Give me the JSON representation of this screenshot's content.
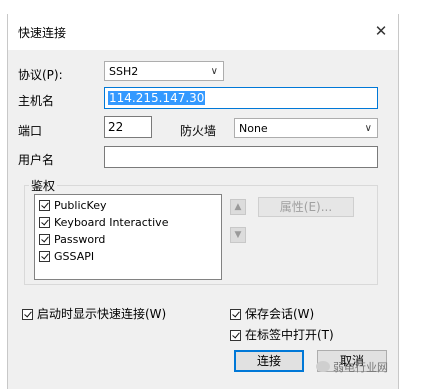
{
  "window": {
    "title": "快速连接"
  },
  "protocol": {
    "label": "协议(P):",
    "value": "SSH2"
  },
  "hostname": {
    "label": "主机名",
    "value": "114.215.147.30"
  },
  "port": {
    "label": "端口",
    "value": "22"
  },
  "firewall": {
    "label": "防火墙",
    "value": "None"
  },
  "username": {
    "label": "用户名",
    "value": ""
  },
  "auth": {
    "legend": "鉴权",
    "methods": [
      "PublicKey",
      "Keyboard Interactive",
      "Password",
      "GSSAPI"
    ],
    "properties_button": "属性(E)..."
  },
  "options": {
    "show_on_startup": "启动时显示快速连接(W)",
    "save_session": "保存会话(W)",
    "open_in_tab": "在标签中打开(T)"
  },
  "buttons": {
    "connect": "连接",
    "cancel": "取消"
  },
  "watermark": {
    "text": "弱电行业网"
  }
}
